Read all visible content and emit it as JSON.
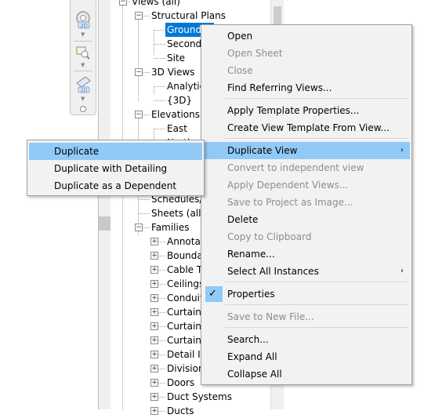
{
  "nav_bar": {
    "icons": [
      "wheel-icon",
      "2d-badge-icon",
      "zoom-region-icon",
      "plane-2d-icon",
      "options-icon"
    ]
  },
  "project_browser": {
    "nodes": [
      {
        "label": "Views (all)",
        "toggle": "-"
      },
      {
        "label": "Structural Plans",
        "toggle": "-"
      },
      {
        "label": "Ground Fl",
        "selected": true
      },
      {
        "label": "Second"
      },
      {
        "label": "Site"
      },
      {
        "label": "3D Views",
        "toggle": "-"
      },
      {
        "label": "Analytic"
      },
      {
        "label": "{3D}"
      },
      {
        "label": "Elevations (B",
        "toggle": "-"
      },
      {
        "label": "East"
      },
      {
        "label": "North"
      },
      {
        "label": "Schedules/Q"
      },
      {
        "label": "Sheets (all)"
      },
      {
        "label": "Families",
        "toggle": "-"
      },
      {
        "label": "Annotation",
        "toggle": "+"
      },
      {
        "label": "Boundary Co",
        "toggle": "+"
      },
      {
        "label": "Cable Trays",
        "toggle": "+"
      },
      {
        "label": "Ceilings",
        "toggle": "+"
      },
      {
        "label": "Conduits",
        "toggle": "+"
      },
      {
        "label": "Curtain Pane",
        "toggle": "+"
      },
      {
        "label": "Curtain Syst",
        "toggle": "+"
      },
      {
        "label": "Curtain Wall",
        "toggle": "+"
      },
      {
        "label": "Detail Items",
        "toggle": "+"
      },
      {
        "label": "Division Pro",
        "toggle": "+"
      },
      {
        "label": "Doors",
        "toggle": "+"
      },
      {
        "label": "Duct Systems",
        "toggle": "+"
      },
      {
        "label": "Ducts",
        "toggle": "+"
      }
    ]
  },
  "context_menu": {
    "items": [
      {
        "label": "Open",
        "enabled": true
      },
      {
        "label": "Open Sheet",
        "enabled": false
      },
      {
        "label": "Close",
        "enabled": false
      },
      {
        "label": "Find Referring Views...",
        "enabled": true
      },
      {
        "label": "Apply Template Properties...",
        "enabled": true
      },
      {
        "label": "Create View Template From View...",
        "enabled": true
      },
      {
        "label": "Duplicate View",
        "enabled": true,
        "highlighted": true,
        "submenu": true
      },
      {
        "label": "Convert to independent view",
        "enabled": false
      },
      {
        "label": "Apply Dependent Views...",
        "enabled": false
      },
      {
        "label": "Save to Project as Image...",
        "enabled": false
      },
      {
        "label": "Delete",
        "enabled": true
      },
      {
        "label": "Copy to Clipboard",
        "enabled": false
      },
      {
        "label": "Rename...",
        "enabled": true
      },
      {
        "label": "Select All Instances",
        "enabled": true,
        "submenu": true
      },
      {
        "label": "Properties",
        "enabled": true,
        "checked": true
      },
      {
        "label": "Save to New File...",
        "enabled": false
      },
      {
        "label": "Search...",
        "enabled": true
      },
      {
        "label": "Expand All",
        "enabled": true
      },
      {
        "label": "Collapse All",
        "enabled": true
      }
    ],
    "submenu_arrow": "›",
    "check_mark": "✓"
  },
  "duplicate_submenu": {
    "items": [
      {
        "label": "Duplicate",
        "highlighted": true
      },
      {
        "label": "Duplicate with Detailing"
      },
      {
        "label": "Duplicate as a Dependent"
      }
    ]
  },
  "colors": {
    "menu_bg": "#f2f2f2",
    "highlight": "#91c9f7",
    "selection": "#0078d7",
    "disabled_text": "#8d8d8d"
  }
}
